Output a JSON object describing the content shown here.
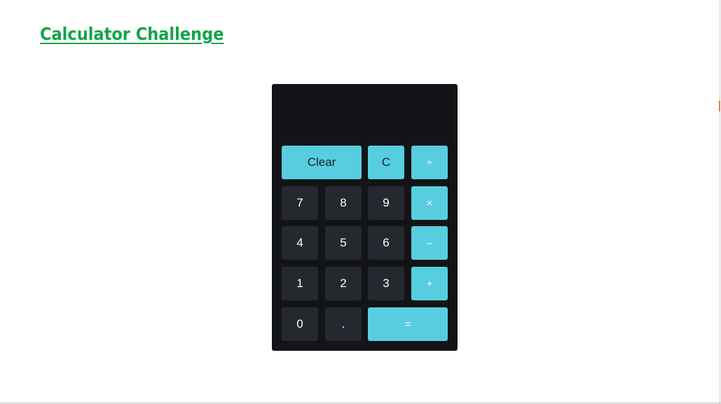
{
  "page": {
    "title": "Calculator Challenge"
  },
  "calculator": {
    "display_value": "",
    "keys": {
      "clear": "Clear",
      "backspace": "C",
      "divide": "÷",
      "seven": "7",
      "eight": "8",
      "nine": "9",
      "multiply": "×",
      "four": "4",
      "five": "5",
      "six": "6",
      "subtract": "–",
      "one": "1",
      "two": "2",
      "three": "3",
      "add": "+",
      "zero": "0",
      "decimal": ".",
      "equals": "="
    }
  },
  "colors": {
    "title": "#13a548",
    "calculator_body": "#131417",
    "number_key": "#262830",
    "accent_key": "#57cedf"
  }
}
